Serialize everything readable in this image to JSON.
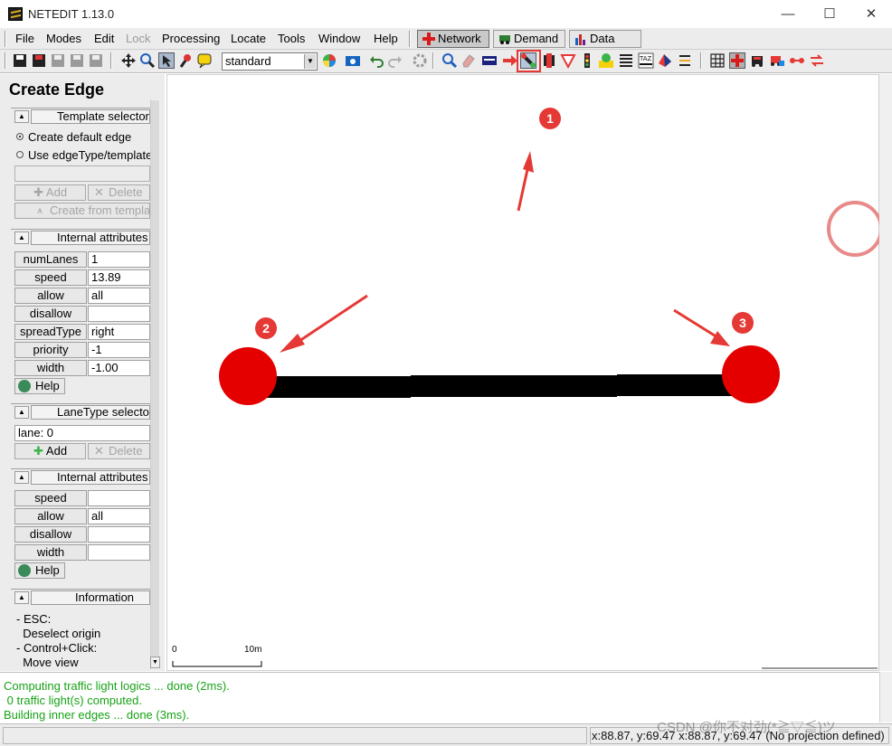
{
  "window": {
    "title": "NETEDIT 1.13.0",
    "minimize": "—",
    "maximize": "☐",
    "close": "✕"
  },
  "menu": {
    "items": [
      "File",
      "Modes",
      "Edit",
      "Lock",
      "Processing",
      "Locate",
      "Tools",
      "Window",
      "Help"
    ],
    "supermodes": [
      "Network",
      "Demand",
      "Data"
    ]
  },
  "toolbar": {
    "scheme": "standard",
    "icons": [
      "save-network-icon",
      "save-all-icon",
      "save-grayed-icon",
      "save-additionals-icon",
      "save-demand-icon",
      "move-view-icon",
      "zoom-icon",
      "select-icon",
      "locate-icon",
      "tooltip-icon",
      "color-wheel-icon",
      "screenshot-icon",
      "undo-icon",
      "redo-icon",
      "settings-icon",
      "inspect-icon",
      "delete-icon",
      "select-mode-icon",
      "move-arrow-icon",
      "create-edge-icon",
      "connections-icon",
      "prohibitions-icon",
      "traffic-light-icon",
      "additional-icon",
      "crossing-icon",
      "taz-icon",
      "polygon-icon",
      "wire-icon",
      "grid-icon",
      "junction-icon",
      "vehicle-icon",
      "vehicle-alt-icon",
      "link-icon",
      "swap-icon"
    ]
  },
  "frame": {
    "title": "Create Edge"
  },
  "template_selector": {
    "title": "Template selector",
    "option_default": "Create default edge",
    "option_template": "Use edgeType/template",
    "add": "Add",
    "delete": "Delete",
    "create_from_template": "Create from template"
  },
  "edge_attributes": {
    "title": "Internal attributes",
    "rows": [
      {
        "label": "numLanes",
        "value": "1"
      },
      {
        "label": "speed",
        "value": "13.89"
      },
      {
        "label": "allow",
        "value": "all"
      },
      {
        "label": "disallow",
        "value": ""
      },
      {
        "label": "spreadType",
        "value": "right"
      },
      {
        "label": "priority",
        "value": "-1"
      },
      {
        "label": "width",
        "value": "-1.00"
      }
    ],
    "help": "Help"
  },
  "lanetype_selector": {
    "title": "LaneType selector",
    "lane": "lane: 0",
    "add": "Add",
    "delete": "Delete"
  },
  "lane_attributes": {
    "title": "Internal attributes",
    "rows": [
      {
        "label": "speed",
        "value": ""
      },
      {
        "label": "allow",
        "value": "all"
      },
      {
        "label": "disallow",
        "value": ""
      },
      {
        "label": "width",
        "value": ""
      }
    ],
    "help": "Help"
  },
  "information": {
    "title": "Information",
    "lines": [
      "- ESC:",
      "  Deselect origin",
      "- Control+Click:",
      "  Move view"
    ]
  },
  "canvas": {
    "scale_start": "0",
    "scale_end": "10m",
    "annotations": [
      "1",
      "2",
      "3"
    ]
  },
  "messages": [
    "Computing traffic light logics ... done (2ms).",
    " 0 traffic light(s) computed.",
    "Building inner edges ... done (3ms)."
  ],
  "status": {
    "coords": "x:88.87, y:69.47  x:88.87, y:69.47 (No projection defined)",
    "watermark": "CSDN @你不对劲(*≧▽≦)ツ"
  },
  "colors": {
    "junction": "#e50000",
    "edge": "#000000",
    "annotation": "#e53935",
    "log_text": "#16a316"
  }
}
